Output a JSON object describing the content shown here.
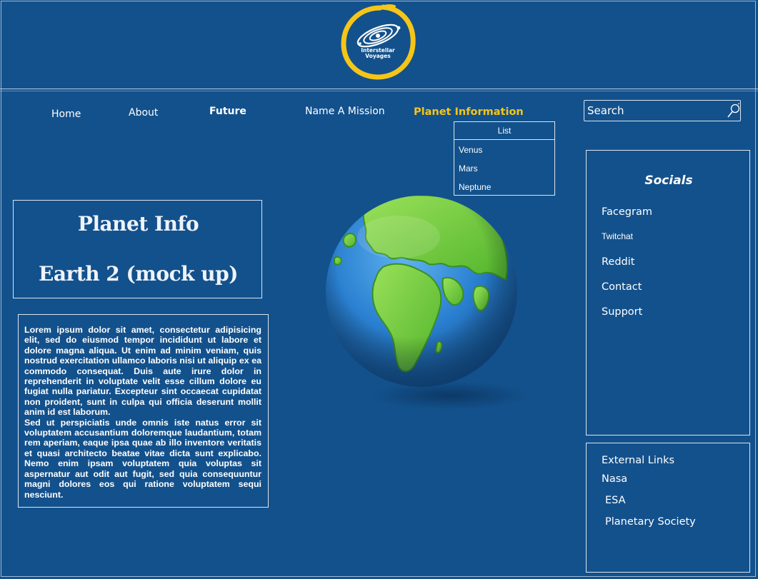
{
  "logo": {
    "line1": "Interstellar",
    "line2": "Voyages"
  },
  "nav": {
    "home": "Home",
    "about": "About",
    "future": "Future",
    "name_mission": "Name A Mission",
    "planet_info": "Planet Information"
  },
  "search": {
    "placeholder": "Search"
  },
  "dropdown": {
    "header": "List",
    "items": [
      "Venus",
      "Mars",
      "Neptune"
    ]
  },
  "planet_box": {
    "title": "Planet Info",
    "subtitle": "Earth 2 (mock up)"
  },
  "lorem": {
    "p1": "Lorem ipsum dolor sit amet, consectetur adipisicing elit, sed do eiusmod tempor incididunt ut labore et dolore magna aliqua. Ut enim ad minim veniam, quis nostrud exercitation ullamco laboris nisi ut aliquip ex ea commodo consequat. Duis aute irure dolor in reprehenderit in voluptate velit esse cillum dolore eu fugiat nulla pariatur. Excepteur sint occaecat cupidatat non proident, sunt in culpa qui officia deserunt mollit anim id est laborum.",
    "p2": "Sed ut perspiciatis unde omnis iste natus error sit voluptatem accusantium doloremque laudantium, totam rem aperiam, eaque ipsa quae ab illo inventore veritatis et quasi architecto beatae vitae dicta sunt explicabo. Nemo enim ipsam voluptatem quia voluptas sit aspernatur aut odit aut fugit, sed quia consequuntur magni dolores eos qui ratione voluptatem sequi nesciunt."
  },
  "socials": {
    "title": "Socials",
    "links": [
      "Facegram",
      "Twitchat",
      "Reddit",
      "Contact",
      "Support"
    ]
  },
  "external": {
    "title": "External Links",
    "links": [
      "Nasa",
      "ESA",
      "Planetary Society"
    ]
  },
  "colors": {
    "background": "#13518c",
    "accent": "#f5c518",
    "land": "#6fcf3a",
    "ocean": "#2a7fd0"
  }
}
